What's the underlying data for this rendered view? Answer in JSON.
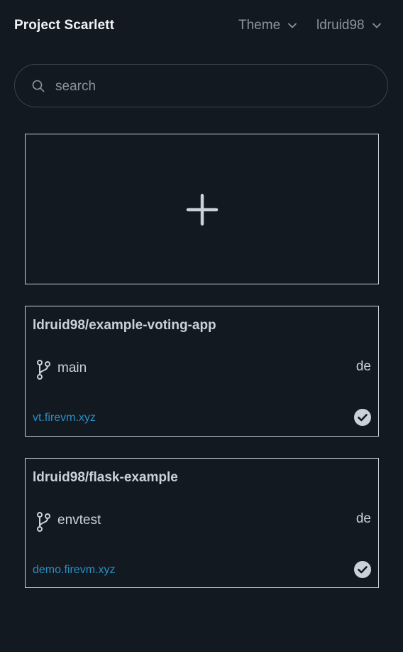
{
  "header": {
    "title": "Project Scarlett",
    "theme_label": "Theme",
    "user_label": "ldruid98"
  },
  "search": {
    "placeholder": "search"
  },
  "add_card": {
    "icon": "plus-icon"
  },
  "projects": [
    {
      "repo": "ldruid98/example-voting-app",
      "branch": "main",
      "region": "de",
      "url": "vt.firevm.xyz",
      "status_icon": "check-circle-icon"
    },
    {
      "repo": "ldruid98/flask-example",
      "branch": "envtest",
      "region": "de",
      "url": "demo.firevm.xyz",
      "status_icon": "check-circle-icon"
    }
  ],
  "colors": {
    "background": "#121921",
    "link": "#2a8fc4",
    "border": "#c9d1d9"
  }
}
